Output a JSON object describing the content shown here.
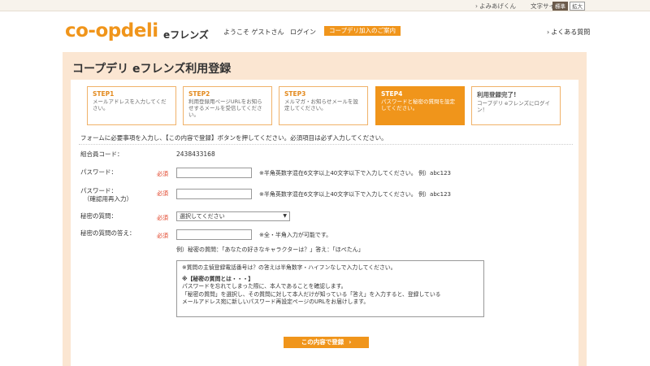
{
  "topbar": {
    "yomi": "よみあげくん",
    "size_label": "文字サイズ",
    "size_standard": "標準",
    "size_large": "拡大"
  },
  "header": {
    "logo_co": "co-op",
    "logo_deli": "deli",
    "logo_sub": "eフレンズ",
    "welcome": "ようこそ ゲストさん",
    "login": "ログイン",
    "guide_button": "コープデリ加入のご案内",
    "faq": "よくある質問"
  },
  "page": {
    "title": "コープデリ eフレンズ利用登録"
  },
  "steps": [
    {
      "title": "STEP1",
      "desc": "メールアドレスを入力してください。"
    },
    {
      "title": "STEP2",
      "desc": "利用登録用ページURLをお知らせするメールを受信してください。"
    },
    {
      "title": "STEP3",
      "desc": "メルマガ・お知らせメールを設定してください。"
    },
    {
      "title": "STEP4",
      "desc": "パスワードと秘密の質問を設定してください。"
    },
    {
      "title": "利用登録完了!",
      "desc": "コープデリ eフレンズにログイン！"
    }
  ],
  "form": {
    "instruction": "フォームに必要事項を入力し、【この内容で登録】ボタンを押してください。必須項目は必ず入力してください。",
    "required_mark": "必須",
    "member_code_label": "組合員コード：",
    "member_code_value": "2438433168",
    "password_label": "パスワード：",
    "password_hint": "※半角英数字混在6文字以上40文字以下で入力してください。 例）abc123",
    "password_confirm_label": "パスワード：",
    "password_confirm_sub": "（確認用再入力）",
    "password_confirm_hint": "※半角英数字混在6文字以上40文字以下で入力してください。 例）abc123",
    "question_label": "秘密の質問：",
    "question_selected": "選択してください",
    "answer_label": "秘密の質問の答え：",
    "answer_hint": "※全・半角入力が可能です。",
    "answer_example": "例）秘密の質問：「あなたの好きなキャラクターは？」答え：「ほぺたん」",
    "note_line1": "※質問の主偵登録電話番号は？の答えは半角数字・ハイフンなしで入力してください。",
    "note_head": "※【秘密の質問とは・・・】",
    "note_line2": "パスワードを忘れてしまった際に、本人であることを確認します。",
    "note_line3": "「秘密の質問」を選択し、その質問に対して本人だけが知っている「答え」を入力すると、登録している",
    "note_line4": "メールアドレス宛に新しいパスワード再設定ページのURLをお届けします。",
    "submit": "この内容で登録"
  }
}
